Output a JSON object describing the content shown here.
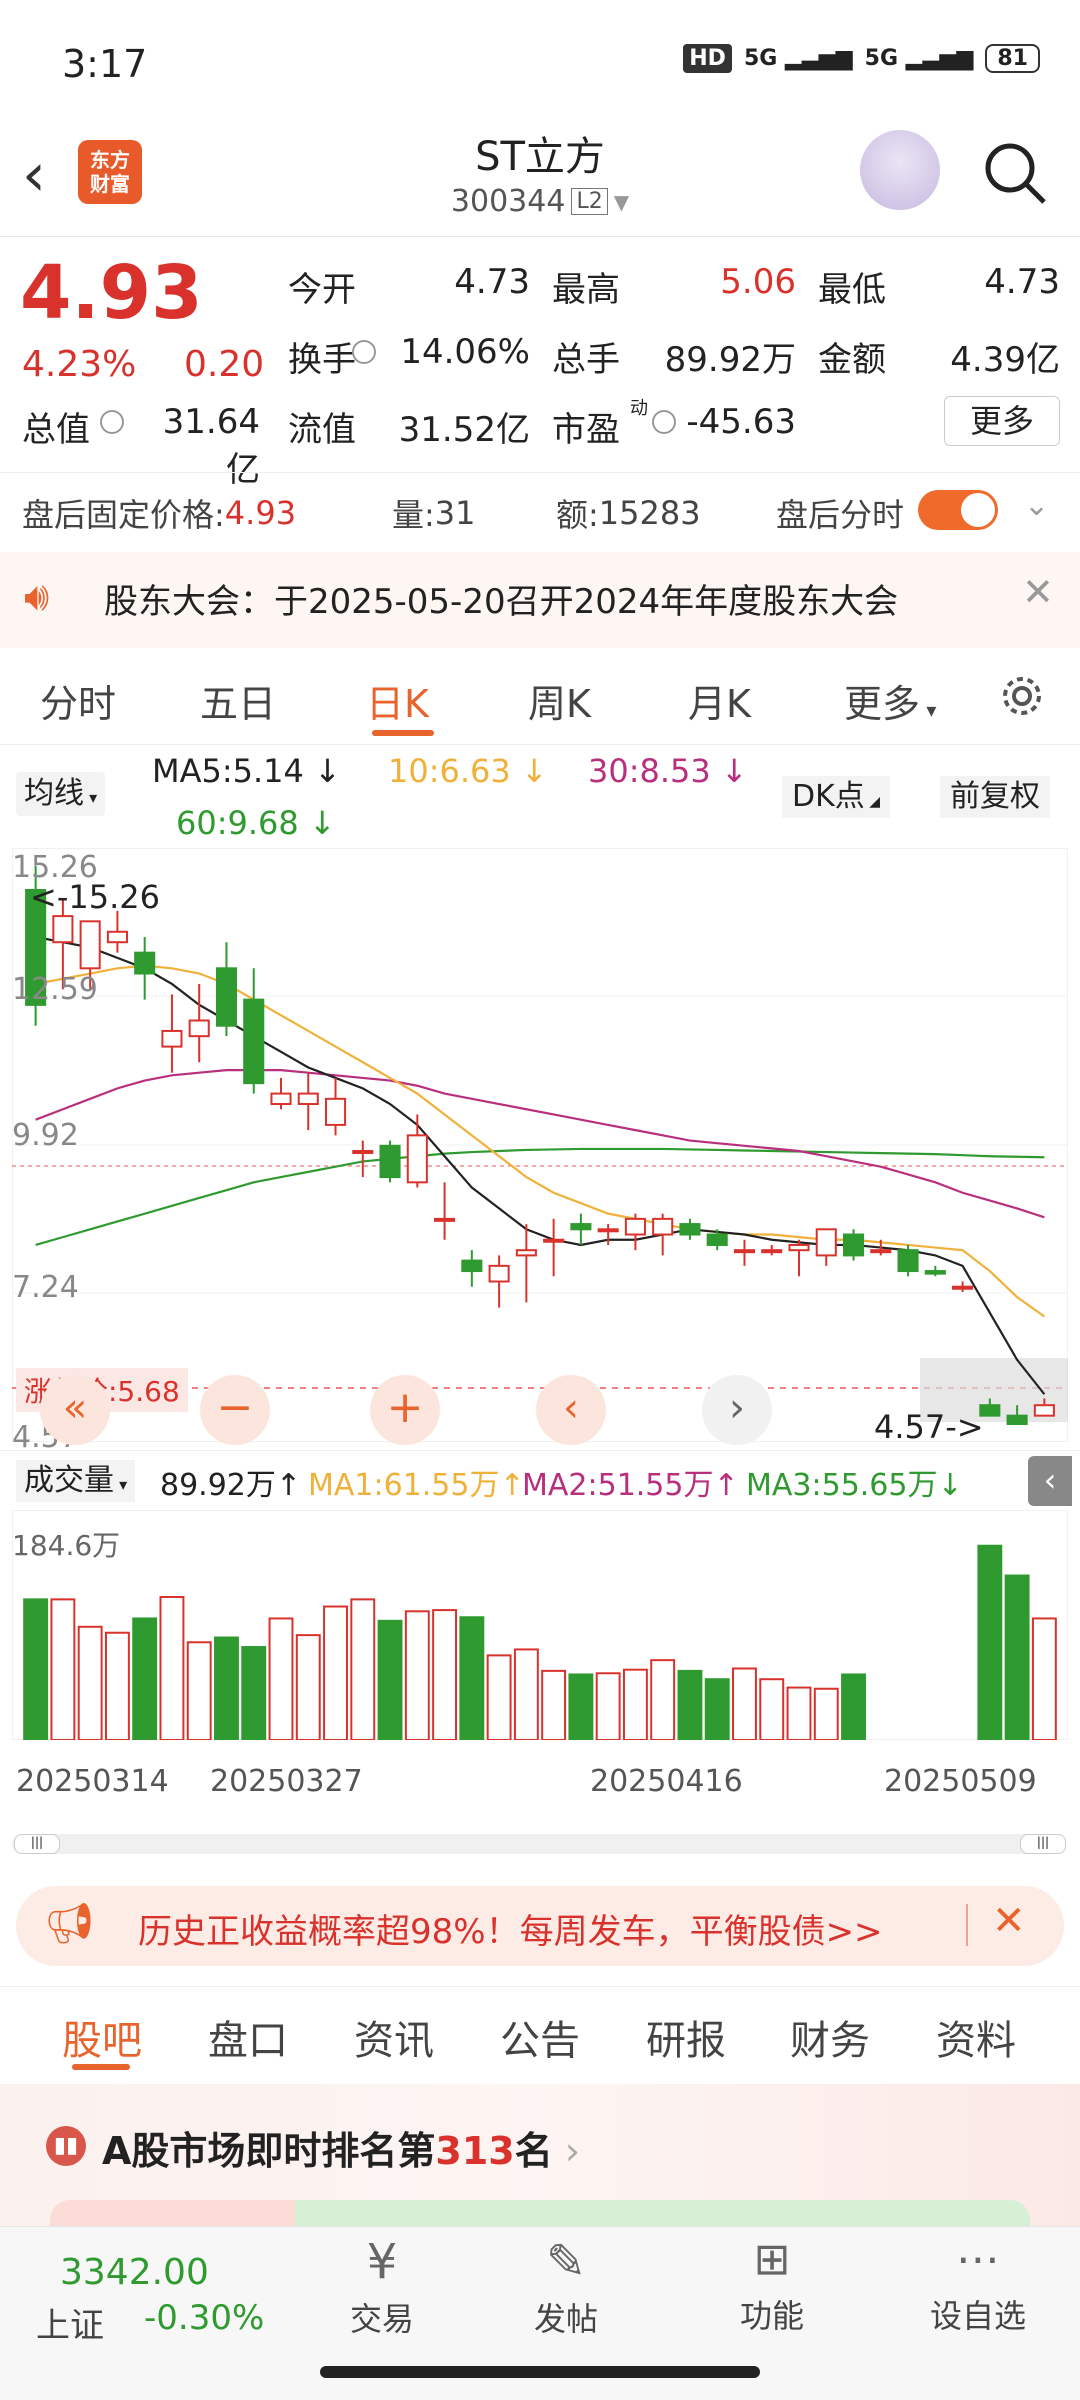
{
  "status": {
    "time": "3:17",
    "hd": "HD",
    "net1": "5G",
    "net2": "5G",
    "battery": "81"
  },
  "header": {
    "title": "ST立方",
    "code": "300344",
    "level": "L2",
    "logo_line1": "东方",
    "logo_line2": "财富"
  },
  "quote": {
    "price": "4.93",
    "pct": "4.23%",
    "chg": "0.20",
    "open_label": "今开",
    "open": "4.73",
    "high_label": "最高",
    "high": "5.06",
    "low_label": "最低",
    "low": "4.73",
    "turnover_label": "换手",
    "turnover": "14.06%",
    "volume_label": "总手",
    "volume": "89.92万",
    "amount_label": "金额",
    "amount": "4.39亿",
    "mcap_label": "总值",
    "mcap": "31.64亿",
    "float_label": "流值",
    "float": "31.52亿",
    "pe_label": "市盈",
    "pe_sup": "动",
    "pe": "-45.63",
    "more": "更多"
  },
  "after_hours": {
    "price_label": "盘后固定价格: ",
    "price": "4.93",
    "qty_label": "量: ",
    "qty": "31",
    "amt_label": "额: ",
    "amt": "15283",
    "toggle_label": "盘后分时"
  },
  "notice": {
    "text": "股东大会：于2025-05-20召开2024年年度股东大会"
  },
  "chart_tabs": [
    {
      "label": "分时"
    },
    {
      "label": "五日"
    },
    {
      "label": "日K"
    },
    {
      "label": "周K"
    },
    {
      "label": "月K"
    },
    {
      "label": "更多"
    }
  ],
  "ma_bar": {
    "selector": "均线",
    "ma5": "MA5:5.14",
    "ma10": "10:6.63",
    "ma30": "30:8.53",
    "ma60": "60:9.68",
    "dk": "DK点",
    "adjust": "前复权"
  },
  "price_axis": {
    "top": "15.26",
    "max_label": "<-15.26",
    "l2": "12.59",
    "l3": "9.92",
    "l4": "7.24",
    "bottom": "4.57",
    "min_label": "4.57->",
    "limit_label": "涨停价:5.68"
  },
  "vol_bar": {
    "selector": "成交量",
    "vol": "89.92万",
    "ma1": "MA1:61.55万",
    "ma2": "MA2:51.55万",
    "ma3": "MA3:55.65万",
    "axis_top": "184.6万"
  },
  "dates": [
    "20250314",
    "20250327",
    "20250416",
    "20250509"
  ],
  "promo": {
    "text": "历史正收益概率超98%！每周发车，平衡股债>>"
  },
  "bottom_tabs": [
    {
      "label": "股吧"
    },
    {
      "label": "盘口"
    },
    {
      "label": "资讯"
    },
    {
      "label": "公告"
    },
    {
      "label": "研报"
    },
    {
      "label": "财务"
    },
    {
      "label": "资料"
    }
  ],
  "rank": {
    "prefix": "A股市场即时排名第",
    "num": "313",
    "suffix": "名"
  },
  "nav": {
    "index_value": "3342.00",
    "index_name": "上证",
    "index_chg": "-0.30%",
    "items": [
      {
        "label": "交易"
      },
      {
        "label": "发帖"
      },
      {
        "label": "功能"
      },
      {
        "label": "设自选"
      }
    ]
  },
  "chart_data": {
    "type": "candlestick",
    "ylim": [
      4.57,
      15.26
    ],
    "candles": [
      {
        "o": 14.8,
        "h": 15.26,
        "l": 12.2,
        "c": 12.6
      },
      {
        "o": 13.8,
        "h": 14.6,
        "l": 12.9,
        "c": 14.3
      },
      {
        "o": 13.3,
        "h": 14.2,
        "l": 12.9,
        "c": 14.2
      },
      {
        "o": 13.8,
        "h": 14.4,
        "l": 13.6,
        "c": 14.0
      },
      {
        "o": 13.6,
        "h": 13.9,
        "l": 12.7,
        "c": 13.2
      },
      {
        "o": 11.8,
        "h": 12.8,
        "l": 11.3,
        "c": 12.1
      },
      {
        "o": 12.0,
        "h": 13.0,
        "l": 11.5,
        "c": 12.3
      },
      {
        "o": 13.3,
        "h": 13.8,
        "l": 12.0,
        "c": 12.2
      },
      {
        "o": 12.7,
        "h": 13.3,
        "l": 10.9,
        "c": 11.1
      },
      {
        "o": 10.7,
        "h": 11.2,
        "l": 10.6,
        "c": 10.9
      },
      {
        "o": 10.7,
        "h": 11.3,
        "l": 10.2,
        "c": 10.9
      },
      {
        "o": 10.3,
        "h": 11.2,
        "l": 10.1,
        "c": 10.8
      },
      {
        "o": 9.8,
        "h": 10.0,
        "l": 9.3,
        "c": 9.8
      },
      {
        "o": 9.9,
        "h": 10.0,
        "l": 9.2,
        "c": 9.3
      },
      {
        "o": 9.2,
        "h": 10.5,
        "l": 9.1,
        "c": 10.1
      },
      {
        "o": 8.5,
        "h": 9.2,
        "l": 8.1,
        "c": 8.5
      },
      {
        "o": 7.7,
        "h": 7.9,
        "l": 7.2,
        "c": 7.5
      },
      {
        "o": 7.3,
        "h": 7.8,
        "l": 6.8,
        "c": 7.6
      },
      {
        "o": 7.8,
        "h": 8.4,
        "l": 6.9,
        "c": 7.9
      },
      {
        "o": 8.1,
        "h": 8.5,
        "l": 7.4,
        "c": 8.1
      },
      {
        "o": 8.4,
        "h": 8.6,
        "l": 8.0,
        "c": 8.3
      },
      {
        "o": 8.3,
        "h": 8.4,
        "l": 8.0,
        "c": 8.3
      },
      {
        "o": 8.2,
        "h": 8.6,
        "l": 7.9,
        "c": 8.5
      },
      {
        "o": 8.2,
        "h": 8.6,
        "l": 7.8,
        "c": 8.5
      },
      {
        "o": 8.4,
        "h": 8.5,
        "l": 8.1,
        "c": 8.2
      },
      {
        "o": 8.2,
        "h": 8.3,
        "l": 7.9,
        "c": 8.0
      },
      {
        "o": 7.9,
        "h": 8.1,
        "l": 7.6,
        "c": 7.9
      },
      {
        "o": 7.9,
        "h": 8.0,
        "l": 7.8,
        "c": 7.9
      },
      {
        "o": 7.9,
        "h": 8.1,
        "l": 7.4,
        "c": 8.0
      },
      {
        "o": 7.8,
        "h": 8.3,
        "l": 7.6,
        "c": 8.3
      },
      {
        "o": 8.2,
        "h": 8.3,
        "l": 7.7,
        "c": 7.8
      },
      {
        "o": 7.9,
        "h": 8.1,
        "l": 7.8,
        "c": 7.9
      },
      {
        "o": 7.9,
        "h": 8.0,
        "l": 7.4,
        "c": 7.5
      },
      {
        "o": 7.5,
        "h": 7.6,
        "l": 7.4,
        "c": 7.45
      },
      {
        "o": 7.2,
        "h": 7.3,
        "l": 7.1,
        "c": 7.2
      },
      {
        "o": 4.93,
        "h": 5.06,
        "l": 4.73,
        "c": 4.73
      },
      {
        "o": 4.73,
        "h": 4.93,
        "l": 4.57,
        "c": 4.57
      },
      {
        "o": 4.73,
        "h": 5.06,
        "l": 4.73,
        "c": 4.93
      }
    ],
    "ma5": [
      13.9,
      13.8,
      13.7,
      13.5,
      13.3,
      13.0,
      12.6,
      12.3,
      12.0,
      11.7,
      11.4,
      11.2,
      11.0,
      10.7,
      10.3,
      9.7,
      9.1,
      8.7,
      8.3,
      8.1,
      8.0,
      8.1,
      8.1,
      8.2,
      8.3,
      8.25,
      8.2,
      8.1,
      8.05,
      8.0,
      8.0,
      7.95,
      7.9,
      7.8,
      7.6,
      6.7,
      5.8,
      5.14
    ],
    "ma10": [
      13.0,
      13.1,
      13.2,
      13.3,
      13.35,
      13.3,
      13.2,
      13.0,
      12.7,
      12.4,
      12.1,
      11.8,
      11.5,
      11.2,
      10.9,
      10.5,
      10.1,
      9.7,
      9.3,
      9.0,
      8.8,
      8.6,
      8.5,
      8.4,
      8.3,
      8.25,
      8.2,
      8.2,
      8.15,
      8.1,
      8.1,
      8.05,
      8.0,
      7.95,
      7.9,
      7.5,
      7.0,
      6.63
    ],
    "ma30": [
      10.4,
      10.6,
      10.8,
      11.0,
      11.15,
      11.25,
      11.3,
      11.35,
      11.35,
      11.35,
      11.3,
      11.25,
      11.2,
      11.15,
      11.05,
      10.9,
      10.8,
      10.7,
      10.6,
      10.5,
      10.4,
      10.3,
      10.2,
      10.1,
      10.0,
      9.95,
      9.9,
      9.85,
      9.8,
      9.7,
      9.6,
      9.5,
      9.35,
      9.2,
      9.0,
      8.85,
      8.7,
      8.53
    ],
    "ma60": [
      8.0,
      8.15,
      8.3,
      8.45,
      8.6,
      8.75,
      8.9,
      9.05,
      9.2,
      9.3,
      9.4,
      9.5,
      9.6,
      9.65,
      9.7,
      9.75,
      9.78,
      9.8,
      9.82,
      9.83,
      9.84,
      9.84,
      9.84,
      9.84,
      9.83,
      9.82,
      9.81,
      9.8,
      9.79,
      9.78,
      9.77,
      9.76,
      9.75,
      9.74,
      9.72,
      9.7,
      9.69,
      9.68
    ],
    "volume": [
      118,
      118,
      95,
      90,
      102,
      120,
      82,
      86,
      78,
      102,
      88,
      112,
      118,
      100,
      108,
      109,
      103,
      71,
      76,
      58,
      55,
      56,
      59,
      67,
      58,
      51,
      60,
      51,
      44,
      43,
      55,
      0,
      0,
      0,
      0,
      163,
      138,
      102
    ],
    "vol_ylim": [
      0,
      184.6
    ]
  }
}
